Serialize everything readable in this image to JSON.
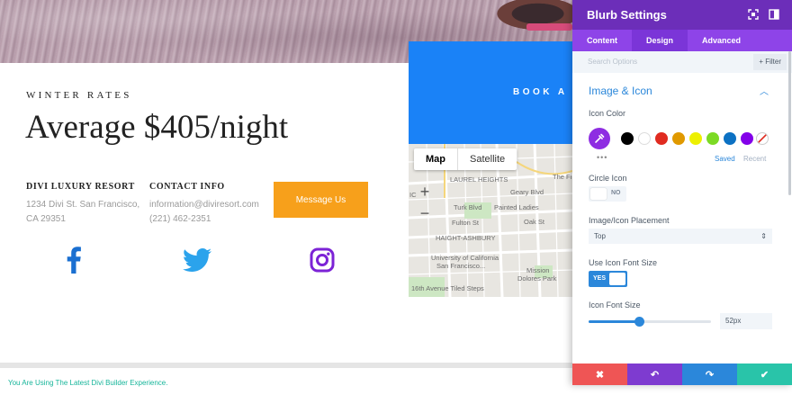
{
  "page": {
    "eyebrow": "WINTER RATES",
    "headline": "Average $405/night",
    "resort": {
      "title": "DIVI LUXURY RESORT",
      "address_line1": "1234 Divi St. San Francisco,",
      "address_line2": "CA 29351"
    },
    "contact": {
      "title": "CONTACT INFO",
      "email": "information@diviresort.com",
      "phone": "(221) 462-2351"
    },
    "message_button": "Message Us",
    "book_label": "BOOK A",
    "social": [
      {
        "icon": "facebook-icon",
        "color": "#1a6fd1"
      },
      {
        "icon": "twitter-icon",
        "color": "#2ba3ec"
      },
      {
        "icon": "instagram-icon",
        "color": "#7c23d6"
      }
    ]
  },
  "map": {
    "map_tab": "Map",
    "satellite_tab": "Satellite",
    "zoom_in": "+",
    "zoom_out": "−",
    "labels": {
      "laurel": "LAUREL HEIGHTS",
      "painted": "Painted Ladies",
      "haight": "HAIGHT-ASHBURY",
      "ucsf_1": "University of California",
      "ucsf_2": "San Francisco...",
      "mission_1": "Mission",
      "mission_2": "Dolores Park",
      "steps": "16th Avenue Tiled Steps",
      "fulton": "Fulton St",
      "turk": "Turk Blvd",
      "geary": "Geary Blvd",
      "oak": "Oak St",
      "the_f": "The Fi",
      "ic": "IC"
    }
  },
  "footer": {
    "notice": "You Are Using The Latest Divi Builder Experience."
  },
  "settings": {
    "title": "Blurb Settings",
    "tabs": [
      "Content",
      "Design",
      "Advanced"
    ],
    "active_tab": "Design",
    "search_placeholder": "Search Options",
    "filter_label": "+ Filter",
    "section": "Image & Icon",
    "icon_color_label": "Icon Color",
    "swatches": [
      "#000000",
      "#ffffff",
      "#e02b20",
      "#e09900",
      "#edf000",
      "#7cda24",
      "#0c71c3",
      "#8300e9"
    ],
    "more": "•••",
    "saved": "Saved",
    "recent": "Recent",
    "circle_icon_label": "Circle Icon",
    "circle_icon_value": "NO",
    "placement_label": "Image/Icon Placement",
    "placement_value": "Top",
    "use_font_size_label": "Use Icon Font Size",
    "use_font_size_value": "YES",
    "font_size_label": "Icon Font Size",
    "font_size_value": "52px",
    "font_size_fraction": 0.41,
    "footer_buttons": [
      {
        "icon": "close-icon",
        "glyph": "✖",
        "color": "#ef5555"
      },
      {
        "icon": "undo-icon",
        "glyph": "↶",
        "color": "#7e3bd0"
      },
      {
        "icon": "redo-icon",
        "glyph": "↷",
        "color": "#2b87da"
      },
      {
        "icon": "save-check-icon",
        "glyph": "✔",
        "color": "#29c4a9"
      }
    ]
  }
}
